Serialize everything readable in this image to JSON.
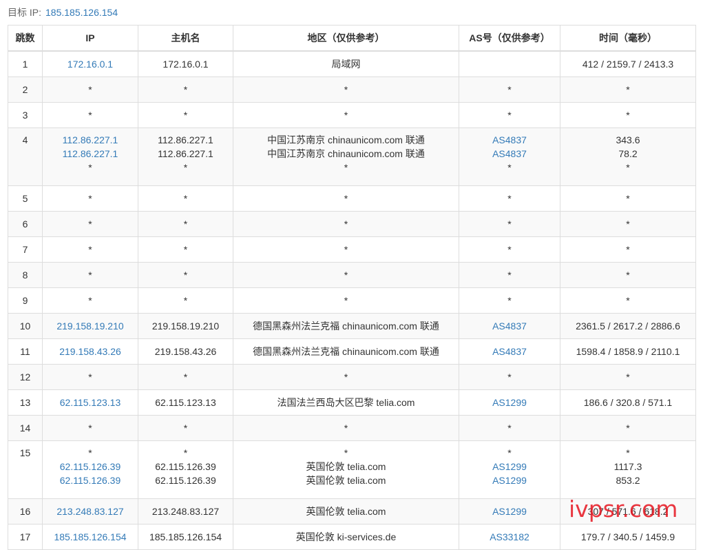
{
  "target": {
    "label": "目标 IP:",
    "ip": "185.185.126.154"
  },
  "columns": [
    "跳数",
    "IP",
    "主机名",
    "地区（仅供参考）",
    "AS号（仅供参考）",
    "时间（毫秒）"
  ],
  "rows": [
    {
      "hop": "1",
      "ip": [
        "172.16.0.1"
      ],
      "host": [
        "172.16.0.1"
      ],
      "region": [
        "局域网"
      ],
      "as": [
        ""
      ],
      "time": [
        "412 / 2159.7 / 2413.3"
      ]
    },
    {
      "hop": "2",
      "ip": [
        "*"
      ],
      "host": [
        "*"
      ],
      "region": [
        "*"
      ],
      "as": [
        "*"
      ],
      "time": [
        "*"
      ]
    },
    {
      "hop": "3",
      "ip": [
        "*"
      ],
      "host": [
        "*"
      ],
      "region": [
        "*"
      ],
      "as": [
        "*"
      ],
      "time": [
        "*"
      ]
    },
    {
      "hop": "4",
      "ip": [
        "112.86.227.1",
        "112.86.227.1",
        "*"
      ],
      "host": [
        "112.86.227.1",
        "112.86.227.1",
        "*"
      ],
      "region": [
        "中国江苏南京 chinaunicom.com 联通",
        "中国江苏南京 chinaunicom.com 联通",
        "*"
      ],
      "as": [
        "AS4837",
        "AS4837",
        "*"
      ],
      "time": [
        "343.6",
        "78.2",
        "*"
      ]
    },
    {
      "hop": "5",
      "ip": [
        "*"
      ],
      "host": [
        "*"
      ],
      "region": [
        "*"
      ],
      "as": [
        "*"
      ],
      "time": [
        "*"
      ]
    },
    {
      "hop": "6",
      "ip": [
        "*"
      ],
      "host": [
        "*"
      ],
      "region": [
        "*"
      ],
      "as": [
        "*"
      ],
      "time": [
        "*"
      ]
    },
    {
      "hop": "7",
      "ip": [
        "*"
      ],
      "host": [
        "*"
      ],
      "region": [
        "*"
      ],
      "as": [
        "*"
      ],
      "time": [
        "*"
      ]
    },
    {
      "hop": "8",
      "ip": [
        "*"
      ],
      "host": [
        "*"
      ],
      "region": [
        "*"
      ],
      "as": [
        "*"
      ],
      "time": [
        "*"
      ]
    },
    {
      "hop": "9",
      "ip": [
        "*"
      ],
      "host": [
        "*"
      ],
      "region": [
        "*"
      ],
      "as": [
        "*"
      ],
      "time": [
        "*"
      ]
    },
    {
      "hop": "10",
      "ip": [
        "219.158.19.210"
      ],
      "host": [
        "219.158.19.210"
      ],
      "region": [
        "德国黑森州法兰克福 chinaunicom.com 联通"
      ],
      "as": [
        "AS4837"
      ],
      "time": [
        "2361.5 / 2617.2 / 2886.6"
      ]
    },
    {
      "hop": "11",
      "ip": [
        "219.158.43.26"
      ],
      "host": [
        "219.158.43.26"
      ],
      "region": [
        "德国黑森州法兰克福 chinaunicom.com 联通"
      ],
      "as": [
        "AS4837"
      ],
      "time": [
        "1598.4 / 1858.9 / 2110.1"
      ]
    },
    {
      "hop": "12",
      "ip": [
        "*"
      ],
      "host": [
        "*"
      ],
      "region": [
        "*"
      ],
      "as": [
        "*"
      ],
      "time": [
        "*"
      ]
    },
    {
      "hop": "13",
      "ip": [
        "62.115.123.13"
      ],
      "host": [
        "62.115.123.13"
      ],
      "region": [
        "法国法兰西岛大区巴黎 telia.com"
      ],
      "as": [
        "AS1299"
      ],
      "time": [
        "186.6 / 320.8 / 571.1"
      ]
    },
    {
      "hop": "14",
      "ip": [
        "*"
      ],
      "host": [
        "*"
      ],
      "region": [
        "*"
      ],
      "as": [
        "*"
      ],
      "time": [
        "*"
      ]
    },
    {
      "hop": "15",
      "ip": [
        "*",
        "62.115.126.39",
        "62.115.126.39"
      ],
      "host": [
        "*",
        "62.115.126.39",
        "62.115.126.39"
      ],
      "region": [
        "*",
        "英国伦敦 telia.com",
        "英国伦敦 telia.com"
      ],
      "as": [
        "*",
        "AS1299",
        "AS1299"
      ],
      "time": [
        "*",
        "1117.3",
        "853.2"
      ]
    },
    {
      "hop": "16",
      "ip": [
        "213.248.83.127"
      ],
      "host": [
        "213.248.83.127"
      ],
      "region": [
        "英国伦敦 telia.com"
      ],
      "as": [
        "AS1299"
      ],
      "time": [
        "307 / 571.6 / 618.2"
      ]
    },
    {
      "hop": "17",
      "ip": [
        "185.185.126.154"
      ],
      "host": [
        "185.185.126.154"
      ],
      "region": [
        "英国伦敦 ki-services.de"
      ],
      "as": [
        "AS33182"
      ],
      "time": [
        "179.7 / 340.5 / 1459.9"
      ]
    }
  ],
  "watermark": "ivpsr.com",
  "colors": {
    "link": "#337ab7",
    "watermark": "#e6141e",
    "border": "#dddddd",
    "stripe": "#f9f9f9"
  }
}
